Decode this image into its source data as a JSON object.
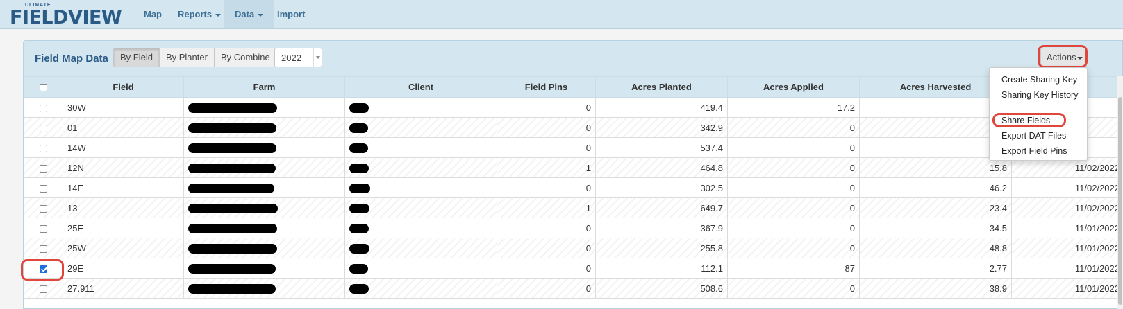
{
  "logo": {
    "small": "CLIMATE",
    "main": "FIELDVIEW"
  },
  "nav": {
    "map": "Map",
    "reports": "Reports",
    "data": "Data",
    "import": "Import"
  },
  "panel": {
    "title": "Field Map Data",
    "views": [
      "By Field",
      "By Planter",
      "By Combine"
    ],
    "year": "2022",
    "actions_label": "Actions"
  },
  "menu": {
    "items": [
      "Create Sharing Key",
      "Sharing Key History",
      "Share Fields",
      "Export DAT Files",
      "Export Field Pins"
    ]
  },
  "table": {
    "headers": [
      "Field",
      "Farm",
      "Client",
      "Field Pins",
      "Acres Planted",
      "Acres Applied",
      "Acres Harvested"
    ],
    "rows": [
      {
        "field": "30W",
        "pins": "0",
        "planted": "419.4",
        "applied": "17.2",
        "harvested": "",
        "date": "",
        "checked": false
      },
      {
        "field": "01",
        "pins": "0",
        "planted": "342.9",
        "applied": "0",
        "harvested": "",
        "date": "",
        "checked": false
      },
      {
        "field": "14W",
        "pins": "0",
        "planted": "537.4",
        "applied": "0",
        "harvested": "",
        "date": "",
        "checked": false
      },
      {
        "field": "12N",
        "pins": "1",
        "planted": "464.8",
        "applied": "0",
        "harvested": "15.8",
        "date": "11/02/2022",
        "checked": false
      },
      {
        "field": "14E",
        "pins": "0",
        "planted": "302.5",
        "applied": "0",
        "harvested": "46.2",
        "date": "11/02/2022",
        "checked": false
      },
      {
        "field": "13",
        "pins": "1",
        "planted": "649.7",
        "applied": "0",
        "harvested": "23.4",
        "date": "11/02/2022",
        "checked": false
      },
      {
        "field": "25E",
        "pins": "0",
        "planted": "367.9",
        "applied": "0",
        "harvested": "34.5",
        "date": "11/01/2022",
        "checked": false
      },
      {
        "field": "25W",
        "pins": "0",
        "planted": "255.8",
        "applied": "0",
        "harvested": "48.8",
        "date": "11/01/2022",
        "checked": false
      },
      {
        "field": "29E",
        "pins": "0",
        "planted": "112.1",
        "applied": "87",
        "harvested": "2.77",
        "date": "11/01/2022",
        "checked": true
      },
      {
        "field": "27.911",
        "pins": "0",
        "planted": "508.6",
        "applied": "0",
        "harvested": "38.9",
        "date": "11/01/2022",
        "checked": false
      }
    ]
  },
  "colors": {
    "highlight": "#e0463b",
    "nav_text": "#3d6f95",
    "header_bg": "#d4e6f0"
  }
}
